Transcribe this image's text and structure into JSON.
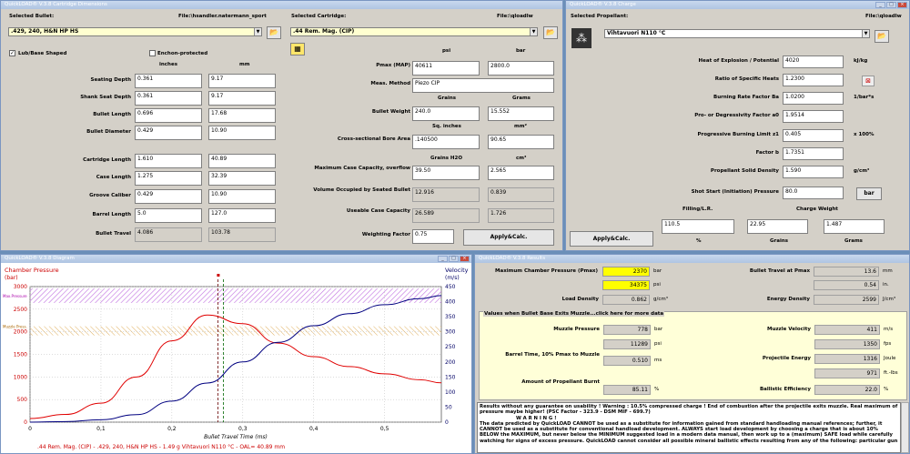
{
  "cartridge": {
    "title": "QuickLOAD® V.3.8 Cartridge Dimensions",
    "selected_bullet_label": "Selected Bullet:",
    "file_label": "File:\\hsandler.natermann_sport",
    "bullet_value": ".429, 240, H&N HP HS",
    "lubrication": "Lub/Base Shaped",
    "enchon": "Enchon-protected",
    "col_inches": "inches",
    "col_mm": "mm",
    "rows": [
      {
        "label": "Seating Depth",
        "in": "0.361",
        "mm": "9.17"
      },
      {
        "label": "Shank Seat Depth",
        "in": "0.361",
        "mm": "9.17"
      },
      {
        "label": "Bullet Length",
        "in": "0.696",
        "mm": "17.68"
      },
      {
        "label": "Bullet Diameter",
        "in": "0.429",
        "mm": "10.90"
      },
      {
        "label": "Cartridge Length",
        "in": "1.610",
        "mm": "40.89"
      },
      {
        "label": "Case Length",
        "in": "1.275",
        "mm": "32.39"
      },
      {
        "label": "Groove Caliber",
        "in": "0.429",
        "mm": "10.90"
      },
      {
        "label": "Barrel Length",
        "in": "5.0",
        "mm": "127.0"
      },
      {
        "label": "Bullet Travel",
        "in": "4.086",
        "mm": "103.78"
      }
    ],
    "selected_cartridge_label": "Selected Cartridge:",
    "cart_file_label": "File:\\qloadlw",
    "cartridge_value": ".44 Rem. Mag. (CIP)",
    "col_psi": "psi",
    "col_bar": "bar",
    "pmax_label": "Pmax (MAP)",
    "pmax_psi": "40611",
    "pmax_bar": "2800.0",
    "meas_label": "Meas. Method",
    "meas_value": "Piezo CIP",
    "grains_label": "Grains",
    "grams_label": "Grams",
    "bw_label": "Bullet Weight",
    "bw_gr": "240.0",
    "bw_g": "15.552",
    "sq_in": "Sq. inches",
    "mm2": "mm²",
    "bore_label": "Cross-sectional Bore Area",
    "bore_in": ".140500",
    "bore_mm": "90.65",
    "gr_h2o": "Grains H2O",
    "cm3": "cm³",
    "mcc_label": "Maximum Case Capacity, overflow",
    "mcc_gr": "39.50",
    "mcc_cm": "2.565",
    "vol_label": "Volume Occupied by Seated Bullet",
    "vol_gr": "12.916",
    "vol_cm": "0.839",
    "ucc_label": "Useable Case Capacity",
    "ucc_gr": "26.589",
    "ucc_cm": "1.726",
    "wf_label": "Weighting Factor",
    "wf_value": "0.75",
    "apply_label": "Apply&Calc."
  },
  "charge": {
    "title": "QuickLOAD® V.3.8 Charge",
    "selected_prop_label": "Selected Propellant:",
    "file_label": "File:\\qloadlw",
    "prop_value": "Vihtavuori N110 °C",
    "rows": [
      {
        "label": "Heat of Explosion / Potential",
        "value": "4020",
        "unit": "kJ/kg"
      },
      {
        "label": "Ratio of Specific Heats",
        "value": "1.2300",
        "unit": ""
      },
      {
        "label": "Burning Rate Factor  Ba",
        "value": "1.0200",
        "unit": "1/bar*s"
      },
      {
        "label": "Pro- or Degressivity Factor  a0",
        "value": "1.9514",
        "unit": ""
      },
      {
        "label": "Progressive Burning Limit z1",
        "value": "0.405",
        "unit": "x 100%"
      },
      {
        "label": "Factor  b",
        "value": "1.7351",
        "unit": ""
      },
      {
        "label": "Propellant Solid Density",
        "value": "1.590",
        "unit": "g/cm³"
      },
      {
        "label": "Shot Start (Initiation) Pressure",
        "value": "80.0",
        "unit": "bar"
      }
    ],
    "filling_label": "Filling/L.R.",
    "cw_label": "Charge Weight",
    "filling": "110.5",
    "cw_grains": "22.95",
    "cw_grams": "1.487",
    "pct": "%",
    "grains": "Grains",
    "grams": "Grams",
    "apply_label": "Apply&Calc."
  },
  "diagram": {
    "title": "QuickLOAD® V.3.8 Diagram",
    "left_title": "Chamber Pressure",
    "left_unit": "(bar)",
    "right_title": "Velocity",
    "right_unit": "(m/s)",
    "max_label": "Max.Pressure",
    "muzzle_label": "Muzzle Press.",
    "xlabel": "Bullet Travel Time (ms)",
    "footer": ".44 Rem. Mag. (CIP) - .429, 240, H&N HP HS - 1.49 g Vihtavuori N110 °C - OAL= 40.89 mm"
  },
  "chart_data": {
    "type": "line",
    "x": [
      0,
      0.05,
      0.1,
      0.15,
      0.2,
      0.25,
      0.3,
      0.35,
      0.4,
      0.45,
      0.5,
      0.55,
      0.58
    ],
    "series": [
      {
        "name": "Chamber Pressure",
        "axis": "left",
        "values": [
          80,
          170,
          420,
          1000,
          1800,
          2370,
          2180,
          1750,
          1450,
          1230,
          1070,
          940,
          870
        ]
      },
      {
        "name": "Velocity",
        "axis": "right",
        "values": [
          0,
          2,
          8,
          25,
          70,
          130,
          200,
          265,
          320,
          360,
          390,
          410,
          420
        ]
      }
    ],
    "xlim": [
      0,
      0.58
    ],
    "ylim_left": [
      0,
      3000
    ],
    "ylim_right": [
      0,
      450
    ],
    "xticks": [
      "0",
      "0,1",
      "0,2",
      "0,3",
      "0,4",
      "0,5"
    ],
    "yticks_left": [
      "0",
      "500",
      "1000",
      "1500",
      "2000",
      "2500",
      "3000"
    ],
    "yticks_right": [
      "0",
      "50",
      "100",
      "150",
      "200",
      "250",
      "300",
      "350",
      "400",
      "450"
    ],
    "max_pressure": 2800,
    "muzzle_pressure": 2000,
    "grid": true
  },
  "results": {
    "title": "QuickLOAD® V.3.8 Results",
    "mcp_label": "Maximum Chamber Pressure (Pmax)",
    "mcp_bar": "2370",
    "mcp_psi": "34375",
    "bar": "bar",
    "psi": "psi",
    "bt_label": "Bullet Travel at Pmax",
    "bt_mm": "13.6",
    "bt_in": "0.54",
    "mm": "mm",
    "in": "in.",
    "ld_label": "Load Density",
    "ld_value": "0.862",
    "ld_unit": "g/cm³",
    "ed_label": "Energy Density",
    "ed_value": "2599",
    "ed_unit": "J/cm³",
    "panel_label": "Values when Bullet Base Exits Muzzle...click here for more data",
    "mp_label": "Muzzle Pressure",
    "mp_bar": "778",
    "mp_psi": "11289",
    "bt2_label": "Barrel Time, 10% Pmax to Muzzle",
    "bt2_value": "0.510",
    "ms": "ms",
    "apb_label": "Amount of Propellant Burnt",
    "apb_value": "85.11",
    "pct": "%",
    "mv_label": "Muzzle Velocity",
    "mv_ms": "411",
    "mv_fps": "1350",
    "ms_unit": "m/s",
    "fps": "fps",
    "pe_label": "Projectile Energy",
    "pe_j": "1316",
    "pe_ftlbs": "971",
    "joule": "Joule",
    "ftlbs": "ft.-lbs",
    "be_label": "Ballistic Efficiency",
    "be_value": "22.0",
    "msg": [
      "Results without any guarantee on usability !  Warning : 10.5% compressed charge !  End of combustion after the projectile exits muzzle.  Real maximum of",
      "pressure maybe higher!  (PSC Factor - 323.9 - DSM MIF - 699.7)",
      "W A R N I N G !",
      "The data predicted by QuickLOAD CANNOT be used as a substitute for information gained from standard handloading manual references; further, it",
      "CANNOT be used as a substitute for conventional handload development.  ALWAYS start load development by choosing a charge that is about 10%",
      "BELOW the MAXIMUM, but never below the MINIMUM suggested load in a modern data manual, then work up to a (maximum) SAFE load while carefully",
      "watching for signs of excess pressure. QuickLOAD cannot consider all possible mineral ballistic effects resulting from any of the following: particular gun"
    ]
  }
}
